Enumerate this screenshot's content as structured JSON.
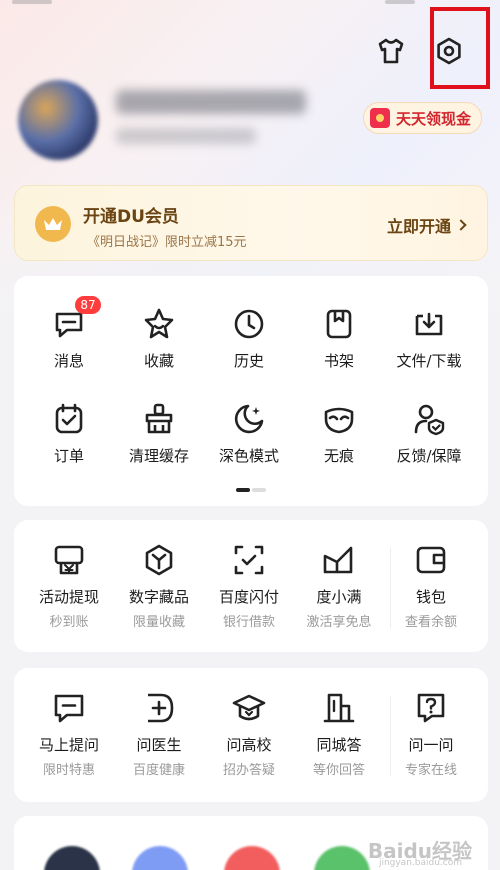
{
  "header": {
    "shirt_icon": "tshirt-icon",
    "settings_icon": "settings-hexagon-icon",
    "cash_button": "天天领现金"
  },
  "vip": {
    "title": "开通DU会员",
    "subtitle": "《明日战记》限时立减15元",
    "action": "立即开通"
  },
  "tools": {
    "row1": [
      {
        "label": "消息",
        "icon": "message-icon",
        "badge": "87"
      },
      {
        "label": "收藏",
        "icon": "star-icon"
      },
      {
        "label": "历史",
        "icon": "clock-icon"
      },
      {
        "label": "书架",
        "icon": "bookmark-icon"
      },
      {
        "label": "文件/下载",
        "icon": "download-icon"
      }
    ],
    "row2": [
      {
        "label": "订单",
        "icon": "order-icon"
      },
      {
        "label": "清理缓存",
        "icon": "broom-icon"
      },
      {
        "label": "深色模式",
        "icon": "moon-icon"
      },
      {
        "label": "无痕",
        "icon": "mask-icon"
      },
      {
        "label": "反馈/保障",
        "icon": "shield-user-icon"
      }
    ]
  },
  "finance": [
    {
      "label": "活动提现",
      "sub": "秒到账",
      "icon": "yuan-icon"
    },
    {
      "label": "数字藏品",
      "sub": "限量收藏",
      "icon": "cube-icon"
    },
    {
      "label": "百度闪付",
      "sub": "银行借款",
      "icon": "scan-pay-icon"
    },
    {
      "label": "度小满",
      "sub": "激活享免息",
      "icon": "dxm-icon"
    },
    {
      "label": "钱包",
      "sub": "查看余额",
      "icon": "wallet-icon"
    }
  ],
  "services": [
    {
      "label": "马上提问",
      "sub": "限时特惠",
      "icon": "ask-icon"
    },
    {
      "label": "问医生",
      "sub": "百度健康",
      "icon": "medical-icon"
    },
    {
      "label": "问高校",
      "sub": "招办答疑",
      "icon": "graduation-cap-icon"
    },
    {
      "label": "同城答",
      "sub": "等你回答",
      "icon": "building-icon"
    },
    {
      "label": "问一问",
      "sub": "专家在线",
      "icon": "question-icon"
    }
  ],
  "watermark": {
    "text": "Baidu经验",
    "sub": "jingyan.baidu.com"
  },
  "colors": {
    "accent_red": "#e0101a",
    "badge": "#ff3d3d",
    "vip_text": "#6b4414",
    "cash_text": "#d2262e"
  }
}
